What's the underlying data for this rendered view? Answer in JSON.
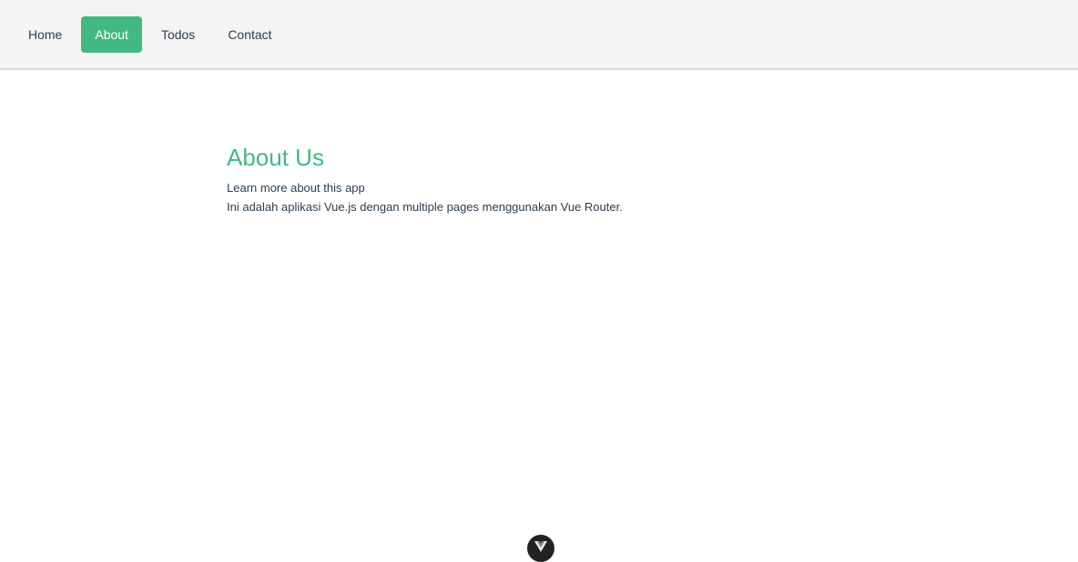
{
  "nav": {
    "items": [
      {
        "label": "Home",
        "active": false
      },
      {
        "label": "About",
        "active": true
      },
      {
        "label": "Todos",
        "active": false
      },
      {
        "label": "Contact",
        "active": false
      }
    ]
  },
  "main": {
    "title": "About Us",
    "subtitle": "Learn more about this app",
    "description": "Ini adalah aplikasi Vue.js dengan multiple pages menggunakan Vue Router."
  },
  "colors": {
    "accent": "#42b983",
    "text": "#2c3e50",
    "navbar_bg": "#f4f4f4"
  },
  "icons": {
    "devtools": "vue-logo-icon"
  }
}
